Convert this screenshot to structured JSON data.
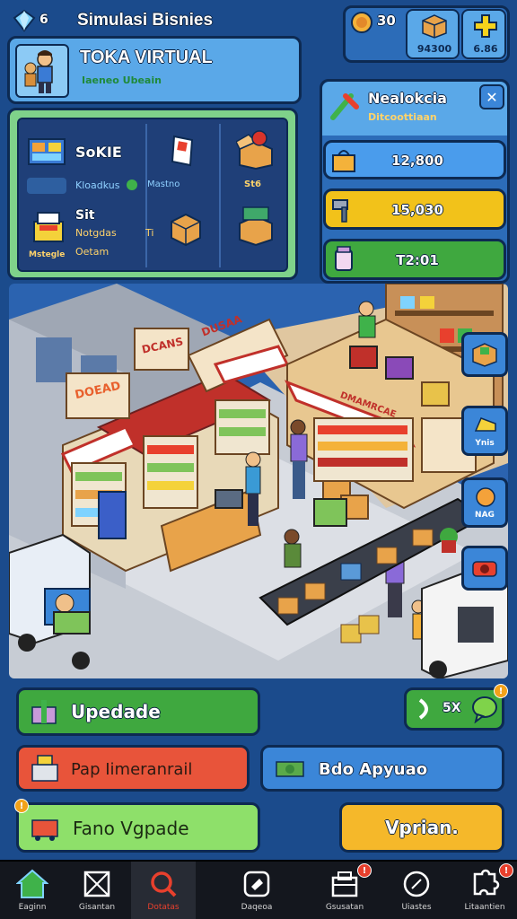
{
  "header": {
    "app_title": "Simulasi Bisnies",
    "gem_count": "6",
    "store_name": "TOKA VIRTUAL",
    "store_subtitle": "Iaeneo Ubeain",
    "coin_count": "30",
    "box_value": "94300",
    "plus_value": "6.86"
  },
  "inventory": {
    "row1_title": "SoKIE",
    "row1_sub_a": "Kloadkus",
    "row1_sub_b": "Mastno",
    "row1_mid_caption": "St6",
    "row2_title": "Sit",
    "row2_sub_a": "Notgdas",
    "row2_sub_b": "Ti",
    "row2_sub_c": "Oetam",
    "row2_left_caption": "Mstegle"
  },
  "notif": {
    "title": "Nealokcia",
    "subtitle": "Ditcoottiaan",
    "close": "✕",
    "rows": [
      {
        "value": "12,800",
        "color": "#3b8fe0"
      },
      {
        "value": "15,030",
        "color": "#f2c21a"
      },
      {
        "value": "T2:01",
        "color": "#3fa83f"
      }
    ]
  },
  "scene": {
    "sign_left": "DOEAD",
    "sign_mid": "DCANS",
    "sign_right": "DUSAA",
    "shop_sign": "DMAMRCAE"
  },
  "side_buttons": [
    {
      "label": ""
    },
    {
      "label": "Ynis"
    },
    {
      "label": "NAG"
    },
    {
      "label": ""
    }
  ],
  "actions": {
    "upgrade_label": "Upedade",
    "boost_label": "5X",
    "left2_label": "Pap Iimeranrail",
    "right2_label": "Bdo Apyuao",
    "left3_label": "Fano Vgpade",
    "right3_label": "Vprian."
  },
  "nav": [
    {
      "label": "Eaginn",
      "icon": "home-icon",
      "badge": ""
    },
    {
      "label": "Gisantan",
      "icon": "box-icon",
      "badge": ""
    },
    {
      "label": "Dotatas",
      "icon": "search-icon",
      "badge": ""
    },
    {
      "label": "Daqeoa",
      "icon": "tag-icon",
      "badge": ""
    },
    {
      "label": "Gsusatan",
      "icon": "store-icon",
      "badge": "!"
    },
    {
      "label": "Uiastes",
      "icon": "compass-icon",
      "badge": ""
    },
    {
      "label": "Litaantien",
      "icon": "puzzle-icon",
      "badge": "!"
    }
  ]
}
